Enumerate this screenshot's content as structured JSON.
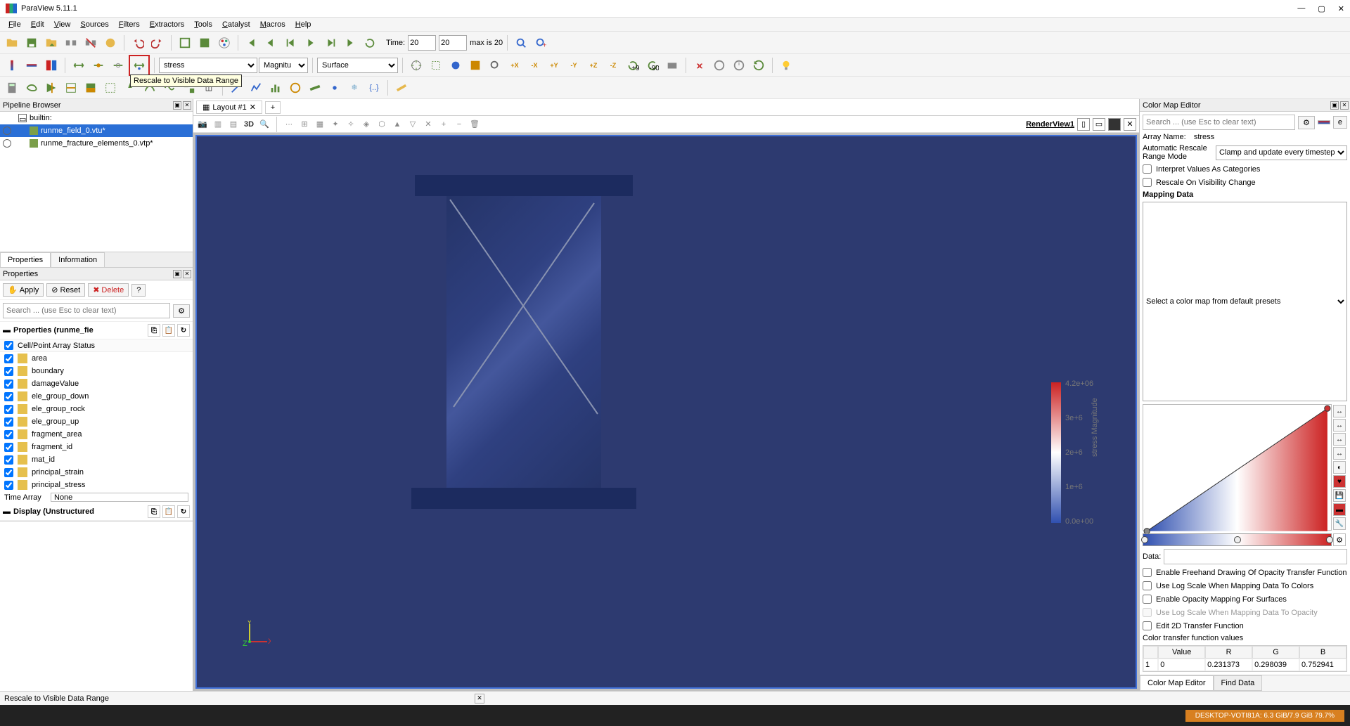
{
  "window": {
    "title": "ParaView 5.11.1"
  },
  "menu": [
    "File",
    "Edit",
    "View",
    "Sources",
    "Filters",
    "Extractors",
    "Tools",
    "Catalyst",
    "Macros",
    "Help"
  ],
  "toolbar2": {
    "array_combo": "stress",
    "component_combo": "Magnitu",
    "repr_combo": "Surface",
    "tooltip": "Rescale to Visible Data Range"
  },
  "time": {
    "label": "Time:",
    "current": "20",
    "max_step": "20",
    "max_label": "max is 20"
  },
  "pipeline": {
    "title": "Pipeline Browser",
    "root": "builtin:",
    "items": [
      {
        "name": "runme_field_0.vtu*",
        "selected": true
      },
      {
        "name": "runme_fracture_elements_0.vtp*",
        "selected": false
      }
    ]
  },
  "prop_tabs": [
    "Properties",
    "Information"
  ],
  "properties": {
    "title": "Properties",
    "apply": "Apply",
    "reset": "Reset",
    "delete": "Delete",
    "search_placeholder": "Search ... (use Esc to clear text)",
    "section1": "Properties (runme_fie",
    "cell_point_status": "Cell/Point Array Status",
    "arrays": [
      "area",
      "boundary",
      "damageValue",
      "ele_group_down",
      "ele_group_rock",
      "ele_group_up",
      "fragment_area",
      "fragment_id",
      "mat_id",
      "principal_strain",
      "principal_stress"
    ],
    "time_array_label": "Time Array",
    "time_array_value": "None",
    "display_section": "Display (Unstructured"
  },
  "layout": {
    "tab": "Layout #1",
    "view_label": "RenderView1"
  },
  "colorbar": {
    "labels": [
      "4.2e+06",
      "3e+6",
      "2e+6",
      "1e+6",
      "0.0e+00"
    ],
    "title": "stress Magnitude"
  },
  "cme": {
    "title": "Color Map Editor",
    "search_placeholder": "Search ... (use Esc to clear text)",
    "array_name_label": "Array Name:",
    "array_name": "stress",
    "rescale_label": "Automatic Rescale Range Mode",
    "rescale_value": "Clamp and update every timestep",
    "chk1": "Interpret Values As Categories",
    "chk2": "Rescale On Visibility Change",
    "mapping_hdr": "Mapping Data",
    "preset_combo": "Select a color map from default presets",
    "data_label": "Data:",
    "opt1": "Enable Freehand Drawing Of Opacity Transfer Function",
    "opt2": "Use Log Scale When Mapping Data To Colors",
    "opt3": "Enable Opacity Mapping For Surfaces",
    "opt4": "Use Log Scale When Mapping Data To Opacity",
    "opt5": "Edit 2D Transfer Function",
    "cvf_label": "Color transfer function values",
    "cvf_head": [
      "Value",
      "R",
      "G",
      "B"
    ],
    "cvf_row": [
      "1",
      "0",
      "0.231373",
      "0.298039",
      "0.752941"
    ],
    "btabs": [
      "Color Map Editor",
      "Find Data"
    ]
  },
  "status": {
    "text": "Rescale to Visible Data Range"
  },
  "taskbar": {
    "mem": "DESKTOP-VOTI81A: 6.3 GiB/7.9 GiB 79.7%"
  }
}
